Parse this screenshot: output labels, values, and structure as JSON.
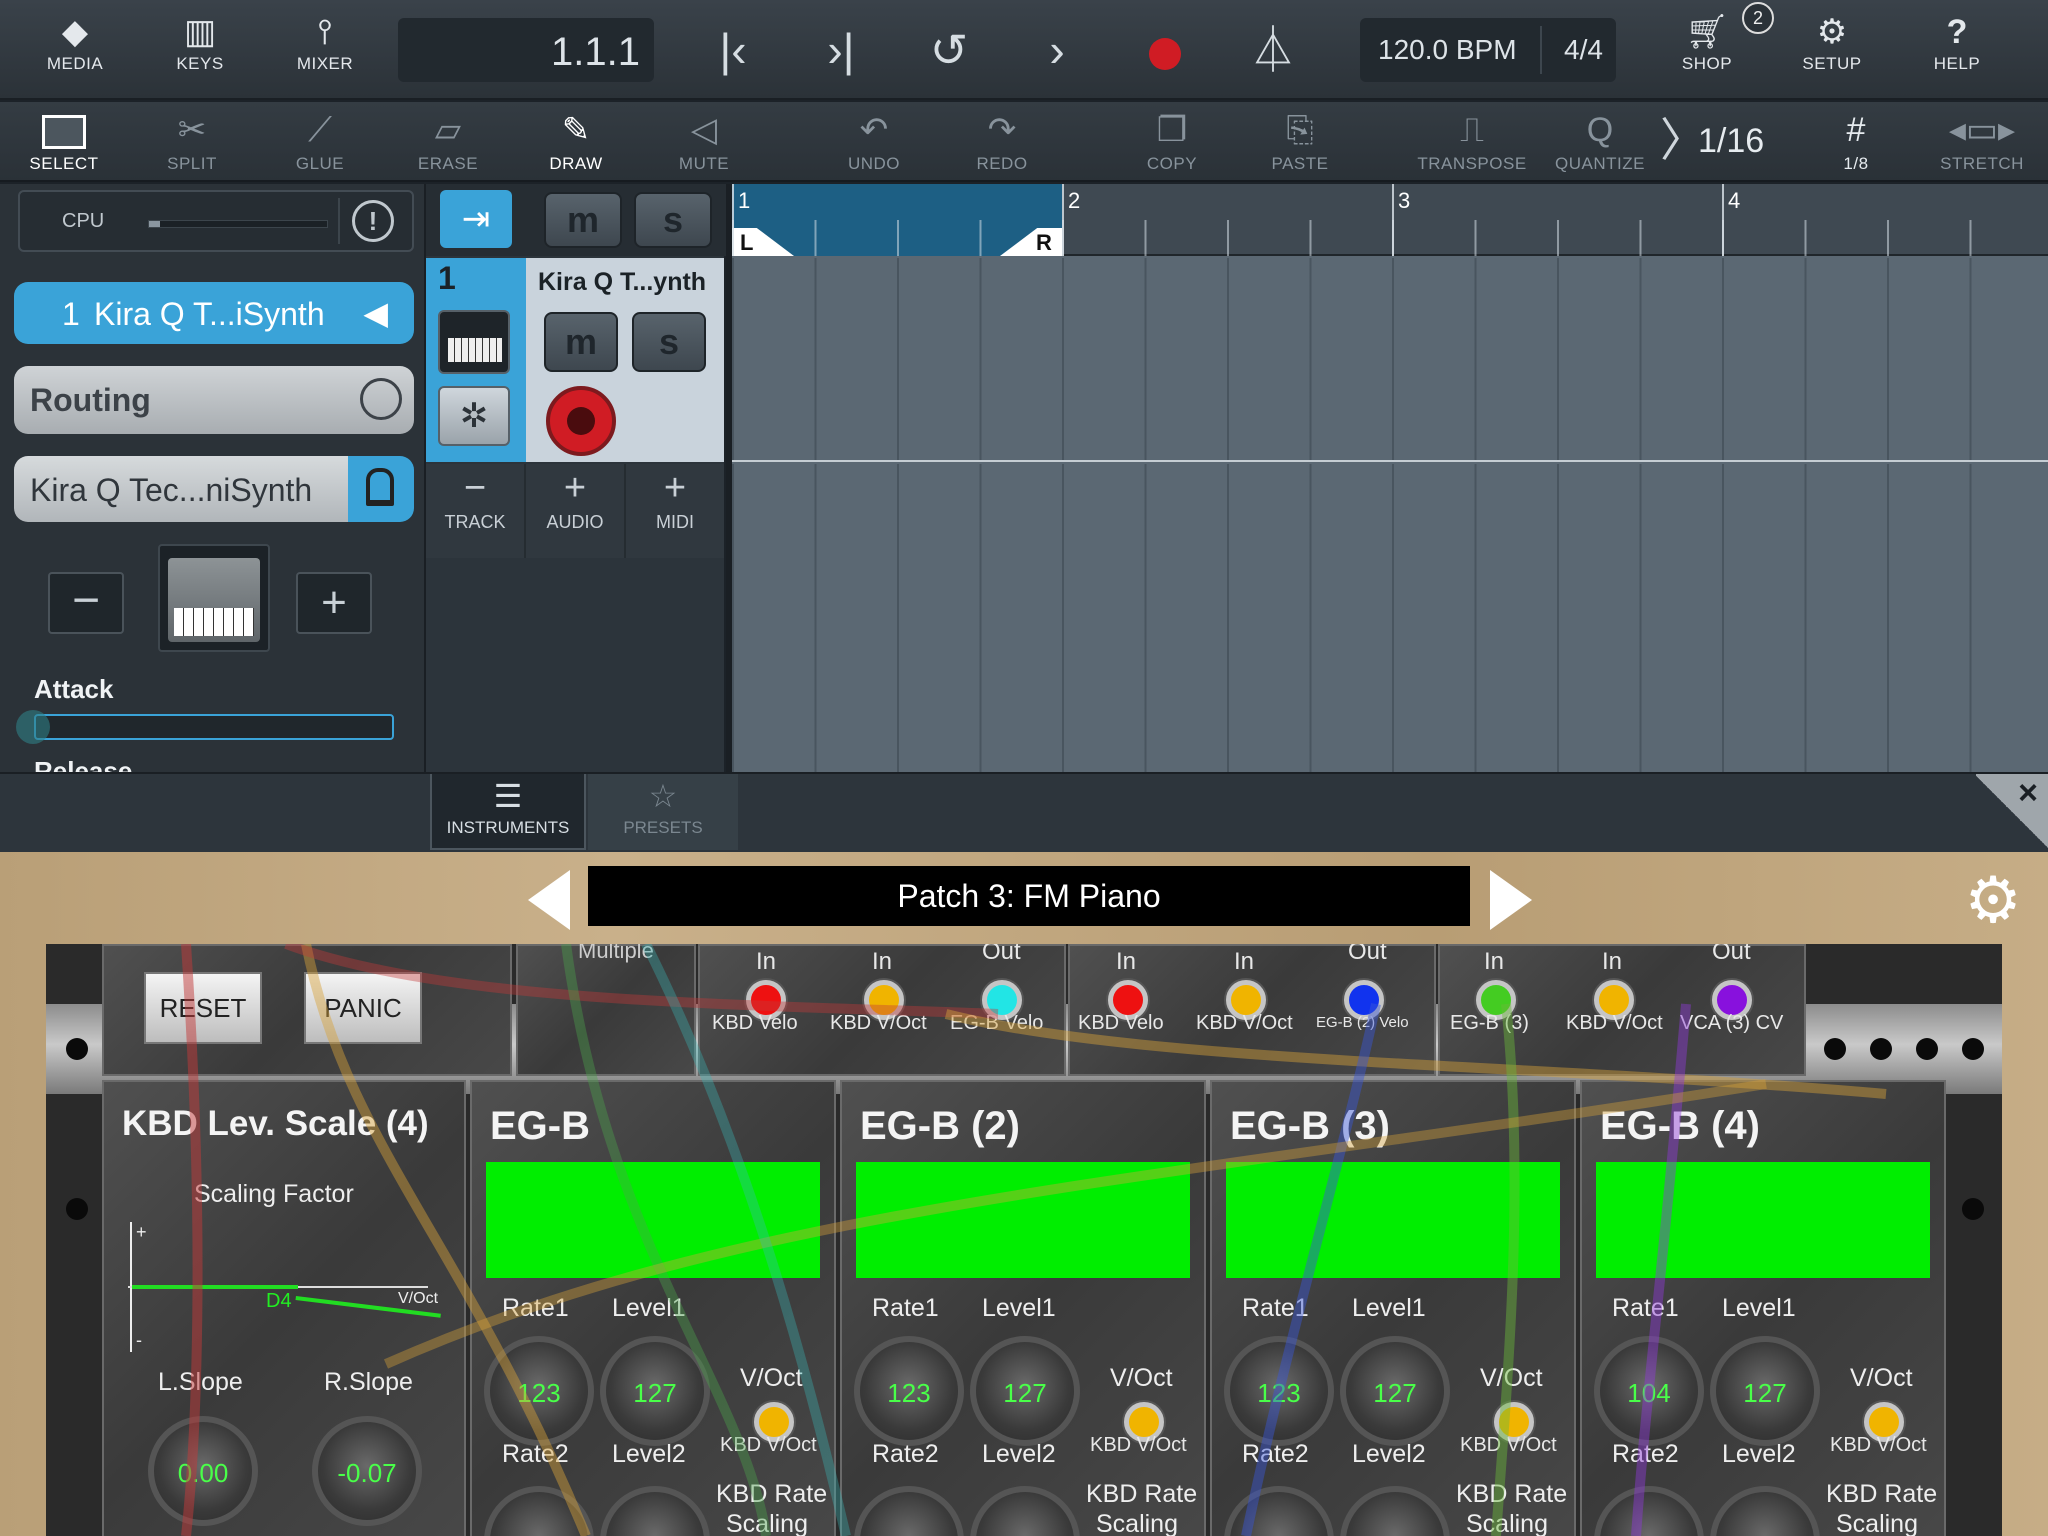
{
  "topbar": {
    "media": "MEDIA",
    "keys": "KEYS",
    "mixer": "MIXER",
    "position": "1.1.1",
    "tempo": "120.0 BPM",
    "signature": "4/4",
    "shop": "SHOP",
    "shop_badge": "2",
    "setup": "SETUP",
    "help": "HELP"
  },
  "editbar": {
    "select": "SELECT",
    "split": "SPLIT",
    "glue": "GLUE",
    "erase": "ERASE",
    "draw": "DRAW",
    "mute": "MUTE",
    "undo": "UNDO",
    "redo": "REDO",
    "copy": "COPY",
    "paste": "PASTE",
    "transpose": "TRANSPOSE",
    "quantize": "QUANTIZE",
    "quantize_value": "1/16",
    "grid": "1/8",
    "stretch": "STRETCH"
  },
  "inspector": {
    "cpu": "CPU",
    "cpu_level": 0.06,
    "track_number": "1",
    "track_name": "Kira Q T...iSynth",
    "routing": "Routing",
    "instrument_name": "Kira Q Tec...niSynth",
    "attack": "Attack",
    "attack_level": 0.0,
    "release": "Release"
  },
  "tracklist": {
    "track_number": "1",
    "track_name": "Kira Q T...ynth",
    "m": "m",
    "s": "s",
    "remove_track": "TRACK",
    "add_audio": "AUDIO",
    "add_midi": "MIDI"
  },
  "ruler": {
    "bars": [
      "1",
      "2",
      "3",
      "4"
    ],
    "left_locator": "L",
    "right_locator": "R"
  },
  "tabs": {
    "instruments": "INSTRUMENTS",
    "presets": "PRESETS",
    "close": "×"
  },
  "synth": {
    "patch": "Patch 3: FM Piano",
    "reset": "RESET",
    "panic": "PANIC",
    "partial_label": "Multiple",
    "jack_groups": [
      {
        "headers": [
          "In",
          "In",
          "Out"
        ],
        "labels": [
          "KBD Velo",
          "KBD V/Oct",
          "EG-B Velo"
        ],
        "colors": [
          "#ee1111",
          "#f0b400",
          "#22e5e5"
        ]
      },
      {
        "headers": [
          "In",
          "In",
          "Out"
        ],
        "labels": [
          "KBD Velo",
          "KBD V/Oct",
          "EG-B (2) Velo"
        ],
        "colors": [
          "#ee1111",
          "#f0b400",
          "#1133ee"
        ]
      },
      {
        "headers": [
          "In",
          "In",
          "Out"
        ],
        "labels": [
          "EG-B (3)",
          "KBD V/Oct",
          "VCA (3) CV"
        ],
        "colors": [
          "#44cc22",
          "#f0b400",
          "#8811dd"
        ]
      }
    ],
    "kbd_module": {
      "title": "KBD Lev. Scale (4)",
      "scaling_factor": "Scaling Factor",
      "plus": "+",
      "minus": "-",
      "note": "D4",
      "axis": "V/Oct",
      "l_slope_label": "L.Slope",
      "l_slope": "0.00",
      "r_slope_label": "R.Slope",
      "r_slope": "-0.07"
    },
    "eg_modules": [
      {
        "title": "EG-B",
        "rate1": "123",
        "level1": "127"
      },
      {
        "title": "EG-B (2)",
        "rate1": "123",
        "level1": "127"
      },
      {
        "title": "EG-B (3)",
        "rate1": "123",
        "level1": "127"
      },
      {
        "title": "EG-B (4)",
        "rate1": "104",
        "level1": "127"
      }
    ],
    "eg_labels": {
      "rate1": "Rate1",
      "level1": "Level1",
      "rate2": "Rate2",
      "level2": "Level2",
      "voct": "V/Oct",
      "kbd_voct": "KBD V/Oct",
      "kbd_rate": "KBD Rate",
      "scaling": "Scaling"
    }
  },
  "colors": {
    "accent": "#3aa3d8",
    "record": "#d01c24",
    "env_green": "#00ee00",
    "knob_value": "#49ff49"
  },
  "icons": {
    "media": "media-icon",
    "keys": "keys-icon",
    "mixer": "mixer-icon",
    "record": "record-icon",
    "metronome": "metronome-icon",
    "shop": "cart-icon",
    "setup": "gear-icon",
    "help": "question-icon"
  }
}
